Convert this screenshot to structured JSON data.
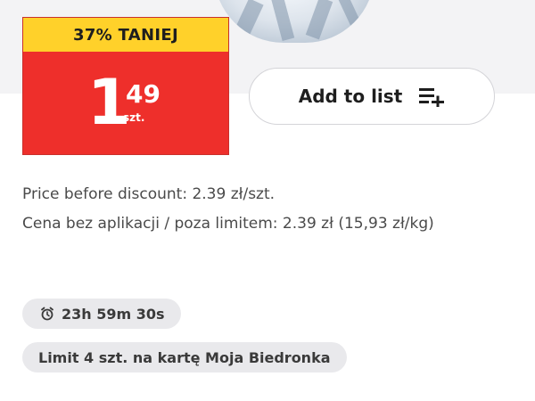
{
  "badge": {
    "discount_text": "37% TANIEJ",
    "price_integer": "1",
    "price_decimal": "49",
    "price_unit": "szt.",
    "strip_color": "#ffd12a",
    "badge_color": "#ee2f2b"
  },
  "add_button": {
    "label": "Add to list",
    "icon": "playlist-add-icon"
  },
  "price_info": {
    "before_discount": "Price before discount: 2.39 zł/szt.",
    "without_app": "Cena bez aplikacji / poza limitem: 2.39 zł (15,93 zł/kg)"
  },
  "timer": {
    "icon": "alarm-clock-icon",
    "text": "23h 59m 30s"
  },
  "limit": {
    "text": "Limit 4 szt. na kartę Moja Biedronka"
  }
}
